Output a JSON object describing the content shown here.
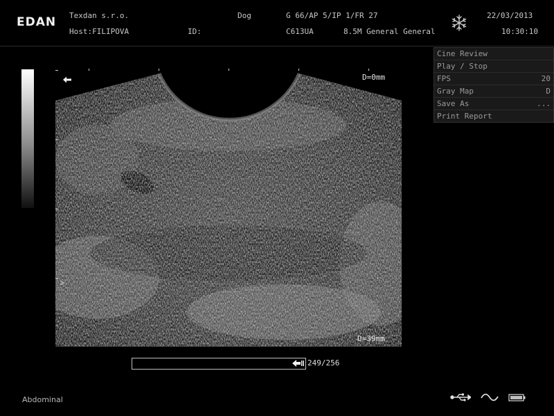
{
  "header": {
    "brand": "EDAN",
    "hospital": "Texdan s.r.o.",
    "operator": "Host:FILIPOVA",
    "patient_type": "Dog",
    "id_label": "ID:",
    "params": "G 66/AP 5/IP 1/FR 27",
    "probe": "C613UA",
    "mode_freq": "8.5M General General",
    "date": "22/03/2013",
    "time": "10:30:10",
    "freeze_icon": "snowflake-icon"
  },
  "cine_menu": {
    "items": [
      {
        "label": "Cine Review",
        "value": ""
      },
      {
        "label": "Play / Stop",
        "value": ""
      },
      {
        "label": "FPS",
        "value": "20"
      },
      {
        "label": "Gray Map",
        "value": "D"
      },
      {
        "label": "Save As",
        "value": "..."
      },
      {
        "label": "Print Report",
        "value": ""
      }
    ]
  },
  "image": {
    "depth_top": "D=0mm",
    "depth_bottom": "D=39mm"
  },
  "cine": {
    "frame_counter": "249/256",
    "current_frame": 249,
    "total_frames": 256
  },
  "footer": {
    "exam_mode": "Abdominal",
    "icons": [
      "usb-icon",
      "ac-power-icon",
      "battery-icon"
    ]
  },
  "colors": {
    "background": "#000000",
    "text": "#cfcfcf",
    "menu_bg": "#1a1a1a"
  }
}
